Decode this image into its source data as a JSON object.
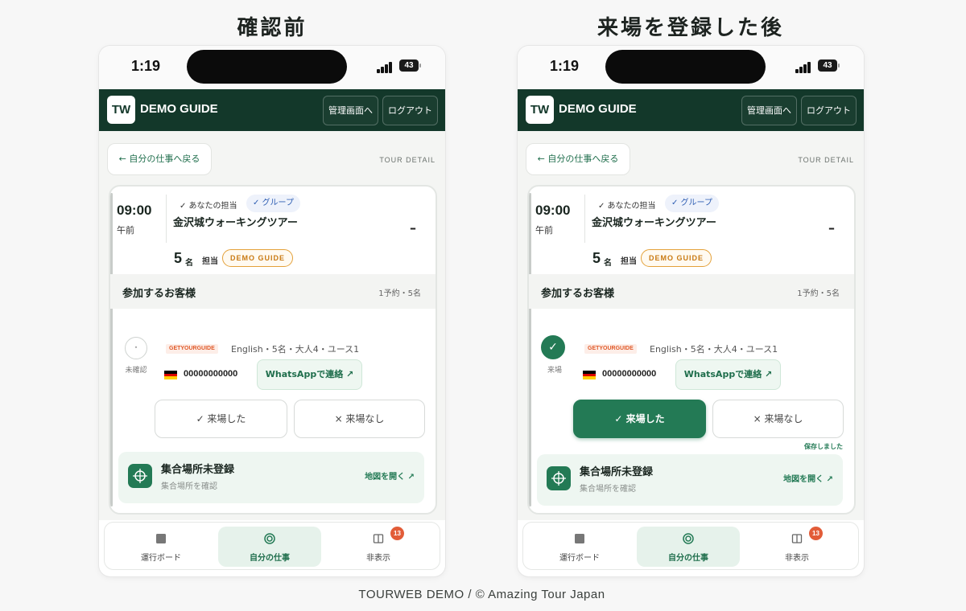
{
  "titles": {
    "before": "確認前",
    "after": "来場を登録した後"
  },
  "colors": {
    "header_bg": "#13382a",
    "accent": "#237a55",
    "gyg": "#e05a2a",
    "badge": "#e25c38",
    "group": "#2f5fb3"
  },
  "status_bar": {
    "time": "1:19",
    "battery": "43"
  },
  "header": {
    "logo": "TW",
    "brand": "DEMO GUIDE",
    "admin_button": "管理画面へ",
    "logout_button": "ログアウト"
  },
  "nav_back": {
    "label": "← 自分の仕事へ戻る",
    "page_label": "TOUR DETAIL"
  },
  "tour": {
    "time": "09:00",
    "ampm": "午前",
    "mine_tag": "✓ あなたの担当",
    "group_tag": "✓ グループ",
    "name": "金沢城ウォーキングツアー",
    "dash": "–",
    "pax": "5",
    "pax_unit": "名",
    "guide_label": "担当",
    "guide_name": "DEMO GUIDE"
  },
  "guests": {
    "title": "参加するお客様",
    "count": "1予約・5名"
  },
  "booking": {
    "source": "GETYOURGUIDE",
    "info": "English・5名・大人4・ユース1",
    "flag": "german-flag-icon",
    "phone": "00000000000",
    "whatsapp": "WhatsAppで連絡 ↗"
  },
  "before": {
    "status_label": "未確認",
    "status_icon": "•"
  },
  "after": {
    "status_label": "来場",
    "status_icon": "✓",
    "saved": "保存しました"
  },
  "actions": {
    "arrived": "✓ 来場した",
    "no_show": "× 来場なし"
  },
  "meeting": {
    "title": "集合場所未登録",
    "subtitle": "集合場所を確認",
    "map_link": "地図を開く ↗"
  },
  "bottom_nav": {
    "board": "運行ボード",
    "mine": "自分の仕事",
    "hidden": "非表示",
    "hidden_badge": "13"
  },
  "footer": "TOURWEB DEMO  /  ©  Amazing Tour Japan"
}
